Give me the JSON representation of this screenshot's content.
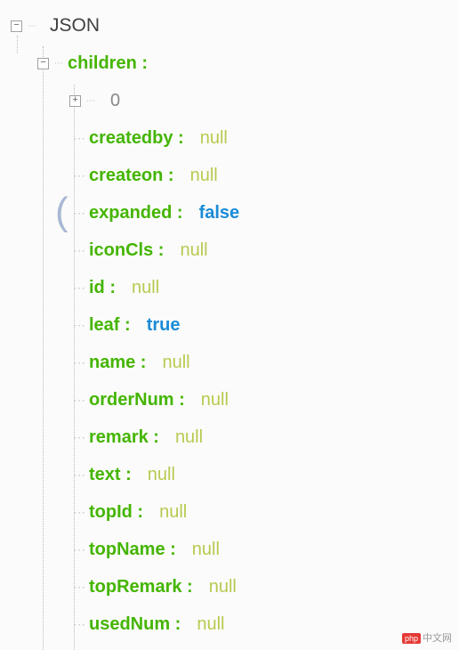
{
  "root": {
    "label": "JSON",
    "toggle": "−"
  },
  "children": {
    "label": "children :",
    "toggle": "−",
    "child_toggle": "+",
    "child_index": "0"
  },
  "properties": [
    {
      "key": "createdby :",
      "value": "null",
      "type": "null",
      "highlight": false
    },
    {
      "key": "createon :",
      "value": "null",
      "type": "null",
      "highlight": false
    },
    {
      "key": "expanded :",
      "value": "false",
      "type": "bool",
      "highlight": true
    },
    {
      "key": "iconCls :",
      "value": "null",
      "type": "null",
      "highlight": false
    },
    {
      "key": "id :",
      "value": "null",
      "type": "null",
      "highlight": false
    },
    {
      "key": "leaf :",
      "value": "true",
      "type": "bool",
      "highlight": false
    },
    {
      "key": "name :",
      "value": "null",
      "type": "null",
      "highlight": false
    },
    {
      "key": "orderNum :",
      "value": "null",
      "type": "null",
      "highlight": false
    },
    {
      "key": "remark :",
      "value": "null",
      "type": "null",
      "highlight": false
    },
    {
      "key": "text :",
      "value": "null",
      "type": "null",
      "highlight": false
    },
    {
      "key": "topId :",
      "value": "null",
      "type": "null",
      "highlight": false
    },
    {
      "key": "topName :",
      "value": "null",
      "type": "null",
      "highlight": false
    },
    {
      "key": "topRemark :",
      "value": "null",
      "type": "null",
      "highlight": false
    },
    {
      "key": "usedNum :",
      "value": "null",
      "type": "null",
      "highlight": false
    }
  ],
  "watermark": "中文网"
}
